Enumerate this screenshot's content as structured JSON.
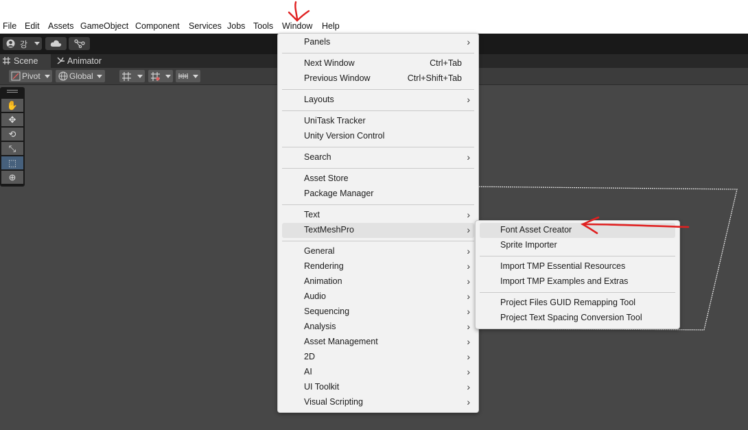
{
  "menubar": {
    "items": [
      "File",
      "Edit",
      "Assets",
      "GameObject",
      "Component",
      "Services",
      "Jobs",
      "Tools",
      "Window",
      "Help"
    ]
  },
  "toolbar": {
    "account_label": "강",
    "account_icon": "account-icon",
    "cloud_icon": "cloud-icon",
    "collab_icon": "version-control-icon"
  },
  "tabs": {
    "scene": "Scene",
    "animator": "Animator"
  },
  "scene_toolbar": {
    "pivot": "Pivot",
    "global": "Global"
  },
  "tools": [
    "hand-tool-icon",
    "move-tool-icon",
    "rotate-tool-icon",
    "scale-tool-icon",
    "rect-tool-icon",
    "transform-tool-icon"
  ],
  "window_menu": {
    "items": [
      {
        "label": "Panels",
        "submenu": true
      },
      {
        "label": "Next Window",
        "shortcut": "Ctrl+Tab"
      },
      {
        "label": "Previous Window",
        "shortcut": "Ctrl+Shift+Tab"
      },
      {
        "label": "Layouts",
        "submenu": true
      },
      {
        "label": "UniTask Tracker"
      },
      {
        "label": "Unity Version Control"
      },
      {
        "label": "Search",
        "submenu": true
      },
      {
        "label": "Asset Store"
      },
      {
        "label": "Package Manager"
      },
      {
        "label": "Text",
        "submenu": true
      },
      {
        "label": "TextMeshPro",
        "submenu": true,
        "highlighted": true
      },
      {
        "label": "General",
        "submenu": true
      },
      {
        "label": "Rendering",
        "submenu": true
      },
      {
        "label": "Animation",
        "submenu": true
      },
      {
        "label": "Audio",
        "submenu": true
      },
      {
        "label": "Sequencing",
        "submenu": true
      },
      {
        "label": "Analysis",
        "submenu": true
      },
      {
        "label": "Asset Management",
        "submenu": true
      },
      {
        "label": "2D",
        "submenu": true
      },
      {
        "label": "AI",
        "submenu": true
      },
      {
        "label": "UI Toolkit",
        "submenu": true
      },
      {
        "label": "Visual Scripting",
        "submenu": true
      }
    ]
  },
  "tmp_submenu": {
    "items": [
      {
        "label": "Font Asset Creator",
        "highlighted": true
      },
      {
        "label": "Sprite Importer"
      },
      {
        "label": "Import TMP Essential Resources"
      },
      {
        "label": "Import TMP Examples and Extras"
      },
      {
        "label": "Project Files GUID Remapping Tool"
      },
      {
        "label": "Project Text Spacing Conversion Tool"
      }
    ]
  },
  "colors": {
    "annotation": "#e02020",
    "scene_bg": "#474747",
    "menu_bg": "#f2f2f2",
    "selected_tool": "#46607c"
  }
}
